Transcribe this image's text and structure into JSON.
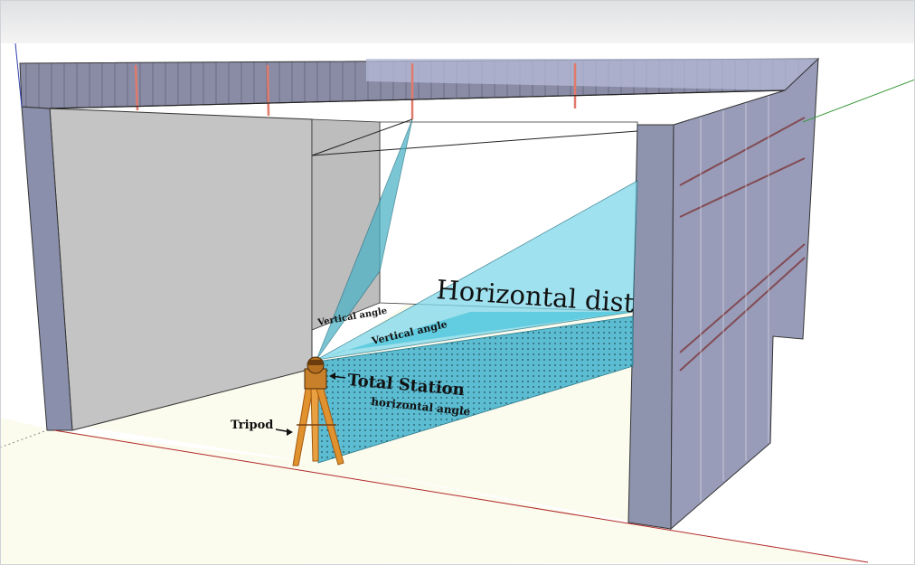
{
  "labels": {
    "horizontal_distance": "Horizontal dist",
    "vertical_angle": "Vertical angle",
    "vertical_angle_small": "Vertical angle",
    "total_station": "Total Station",
    "horizontal_angle": "horizontal angle",
    "tripod": "Tripod"
  },
  "colors": {
    "toolbar": "#e6e7e8",
    "ground": "#fbfbee",
    "wall_gray": "#c2c2c2",
    "wall_blue": "#8e93ad",
    "roof": "#7d7f97",
    "roof_light": "#b9bdd6",
    "beam": "#e07a6a",
    "cyan": "#48c4dc",
    "cyan_light": "#9fe3f0",
    "tripod": "#e0922f",
    "axis_red": "#b22a2a",
    "axis_green": "#3a9a3a",
    "axis_blue": "#2e3fb0"
  }
}
